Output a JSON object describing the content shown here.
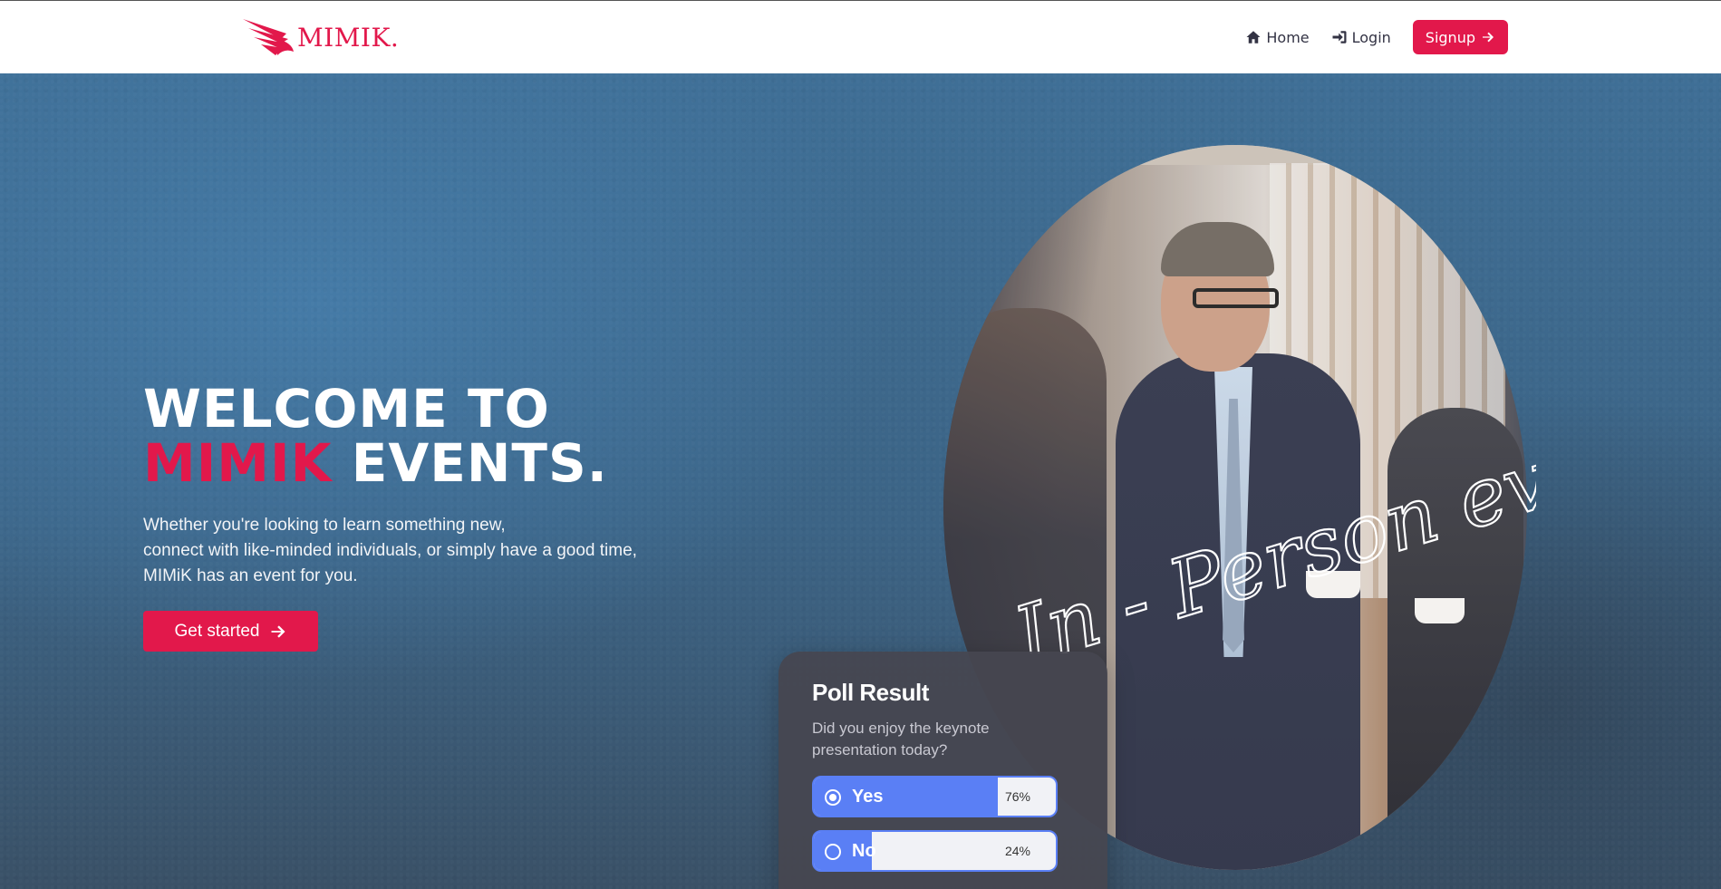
{
  "navbar": {
    "brand": "MIMIK.",
    "links": [
      {
        "label": "Home",
        "icon": "home-icon"
      },
      {
        "label": "Login",
        "icon": "sign-in-icon"
      }
    ],
    "signup_label": "Signup",
    "signup_icon": "arrow-right-icon",
    "accent_color": "#e2184b"
  },
  "hero": {
    "headline_line1": "WELCOME TO",
    "headline_accent": "MIMIK",
    "headline_rest": "EVENTS.",
    "subtext_lines": [
      "Whether you're looking to learn something new,",
      "connect with like-minded individuals, or simply have a good time,",
      "MIMiK has an event for you."
    ],
    "cta_label": "Get started",
    "cta_icon": "arrow-right-icon",
    "script_text": "In - Person events"
  },
  "poll": {
    "title": "Poll Result",
    "question": "Did you enjoy the keynote presentation today?",
    "options": [
      {
        "label": "Yes",
        "percent_text": "76%",
        "percent": 76,
        "selected": true
      },
      {
        "label": "No",
        "percent_text": "24%",
        "percent": 24,
        "selected": false
      }
    ],
    "bar_color": "#5a7ff5"
  }
}
